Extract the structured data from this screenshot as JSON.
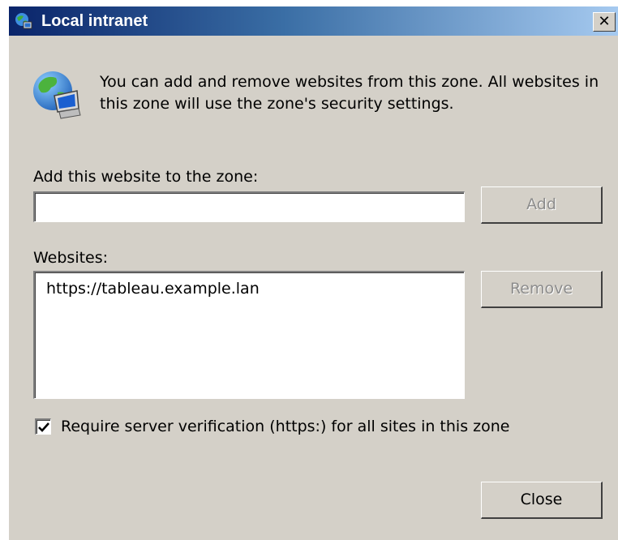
{
  "window": {
    "title": "Local intranet",
    "close_glyph": "✕"
  },
  "intro_text": "You can add and remove websites from this zone. All websites in this zone will use the zone's security settings.",
  "add_section": {
    "label": "Add this website to the zone:",
    "input_value": "",
    "add_button": "Add",
    "add_button_enabled": false
  },
  "websites_section": {
    "label": "Websites:",
    "items": [
      "https://tableau.example.lan"
    ],
    "remove_button": "Remove",
    "remove_button_enabled": false
  },
  "require_verification": {
    "label": "Require server verification (https:) for all sites in this zone",
    "checked": true
  },
  "close_button": "Close",
  "icons": {
    "title_icon": "zone-globe-icon",
    "intro_icon": "globe-computer-icon"
  },
  "colors": {
    "titlebar_start": "#0a246a",
    "titlebar_end": "#a6caf0",
    "dialog_bg": "#d4d0c8"
  }
}
